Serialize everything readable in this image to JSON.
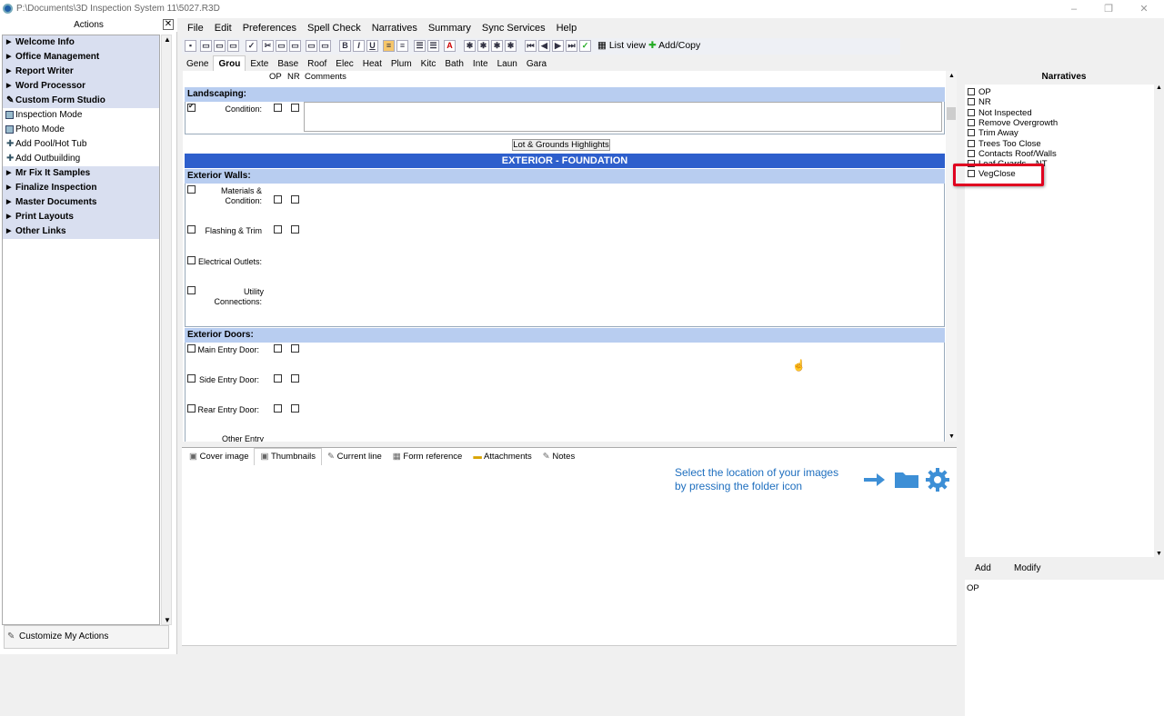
{
  "window": {
    "title": "P:\\Documents\\3D Inspection System 11\\5027.R3D"
  },
  "actions": {
    "header": "Actions",
    "items": [
      {
        "label": "Welcome Info",
        "style": "bold",
        "icon": "triangle-right"
      },
      {
        "label": "Office Management",
        "style": "bold",
        "icon": "triangle-right"
      },
      {
        "label": "Report Writer",
        "style": "bold",
        "icon": "triangle-right"
      },
      {
        "label": "Word Processor",
        "style": "bold",
        "icon": "triangle-right"
      },
      {
        "label": "Custom Form Studio",
        "style": "bold",
        "icon": "pencil-icon"
      },
      {
        "label": "Inspection Mode",
        "style": "plain",
        "icon": "form-icon"
      },
      {
        "label": "Photo Mode",
        "style": "plain",
        "icon": "form-icon"
      },
      {
        "label": "Add Pool/Hot Tub",
        "style": "plain",
        "icon": "plus-icon"
      },
      {
        "label": "Add Outbuilding",
        "style": "plain",
        "icon": "plus-icon"
      },
      {
        "label": "Mr Fix It Samples",
        "style": "bold",
        "icon": "triangle-right"
      },
      {
        "label": "Finalize Inspection",
        "style": "bold",
        "icon": "triangle-right"
      },
      {
        "label": "Master Documents",
        "style": "bold",
        "icon": "triangle-right"
      },
      {
        "label": "Print Layouts",
        "style": "bold",
        "icon": "triangle-right"
      },
      {
        "label": "Other Links",
        "style": "bold",
        "icon": "triangle-right"
      }
    ],
    "customize": "Customize My Actions"
  },
  "menu": [
    "File",
    "Edit",
    "Preferences",
    "Spell Check",
    "Narratives",
    "Summary",
    "Sync Services",
    "Help"
  ],
  "toolbar": {
    "list_view": "List view",
    "add_copy": "Add/Copy"
  },
  "tabs": [
    "Gene",
    "Grou",
    "Exte",
    "Base",
    "Roof",
    "Elec",
    "Heat",
    "Plum",
    "Kitc",
    "Bath",
    "Inte",
    "Laun",
    "Gara"
  ],
  "active_tab": "Grou",
  "form": {
    "col_op": "OP",
    "col_nr": "NR",
    "col_comments": "Comments",
    "landscaping": {
      "title": "Landscaping:",
      "condition": "Condition:"
    },
    "highlights_button": "Lot & Grounds Highlights",
    "banner": "EXTERIOR - FOUNDATION",
    "walls": {
      "title": "Exterior Walls:",
      "materials_1": "Materials &",
      "materials_2": "Condition:",
      "flashing": "Flashing & Trim",
      "outlets": "Electrical Outlets:",
      "utility_1": "Utility",
      "utility_2": "Connections:"
    },
    "doors": {
      "title": "Exterior Doors:",
      "main": "Main Entry Door:",
      "side": "Side Entry Door:",
      "rear": "Rear Entry Door:",
      "other": "Other Entry"
    }
  },
  "bottom_tabs": [
    "Cover image",
    "Thumbnails",
    "Current line",
    "Form reference",
    "Attachments",
    "Notes"
  ],
  "active_bottom_tab": "Thumbnails",
  "hint": {
    "line1": "Select the location of your images",
    "line2": "by pressing the folder icon"
  },
  "narratives": {
    "header": "Narratives",
    "items": [
      "OP",
      "NR",
      "Not Inspected",
      "Remove Overgrowth",
      "Trim Away",
      "Trees Too Close",
      "Contacts Roof/Walls",
      "Leaf Guards... NT",
      "VegClose"
    ],
    "add": "Add",
    "modify": "Modify",
    "preview": "OP"
  },
  "colors": {
    "accent_blue": "#2e5fcc",
    "section_header": "#b8cdf0",
    "highlight_red": "#e00020",
    "hint_blue": "#1f6fbf"
  }
}
